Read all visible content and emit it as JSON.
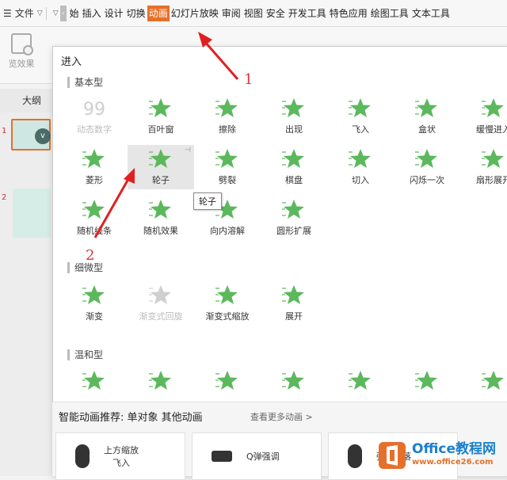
{
  "menubar": {
    "file_label": "文件",
    "tabs": [
      "始",
      "插入",
      "设计",
      "切换",
      "动画",
      "幻灯片放映",
      "审阅",
      "视图",
      "安全",
      "开发工具",
      "特色应用",
      "绘图工具",
      "文本工具"
    ],
    "active_tab": "动画"
  },
  "left": {
    "preview_label": "览效果",
    "outline_label": "大纲",
    "slide_numbers": [
      "1",
      "2"
    ],
    "thumb1_badge": "v"
  },
  "panel": {
    "title": "进入",
    "sections": [
      {
        "label": "基本型",
        "items": [
          "动态数字",
          "百叶窗",
          "擦除",
          "出现",
          "飞入",
          "盒状",
          "缓慢进入",
          "菱形",
          "轮子",
          "劈裂",
          "棋盘",
          "切入",
          "闪烁一次",
          "扇形展开",
          "随机线条",
          "随机效果",
          "向内溶解",
          "圆形扩展"
        ]
      },
      {
        "label": "细微型",
        "items": [
          "渐变",
          "渐变式回旋",
          "渐变式缩放",
          "展开"
        ]
      },
      {
        "label": "温和型",
        "items": []
      }
    ],
    "tooltip": "轮子"
  },
  "smart": {
    "heading": "智能动画推荐:  单对象  其他动画",
    "more_link": "查看更多动画 >",
    "cards": [
      {
        "line1": "上方缩放",
        "line2": "飞入"
      },
      {
        "line1": "Q弹强调",
        "line2": ""
      },
      {
        "line1": "弹性下落",
        "line2": ""
      }
    ]
  },
  "annotations": {
    "num1": "1",
    "num2": "2"
  },
  "watermark": {
    "brand": "Office教程网",
    "url": "www.office26.com"
  },
  "colors": {
    "accent": "#e5702b",
    "star": "#5cb85c",
    "arrow": "#e02020",
    "brand_blue": "#1a7fcf"
  }
}
